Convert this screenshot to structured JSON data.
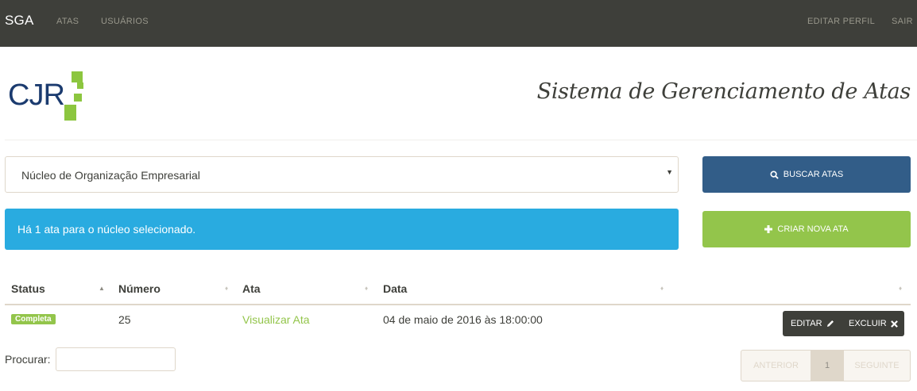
{
  "navbar": {
    "brand": "SGA",
    "links": [
      "ATAS",
      "USUÁRIOS"
    ],
    "right_links": [
      "EDITAR PERFIL",
      "SAIR"
    ]
  },
  "header": {
    "logo_text": "CJR",
    "title": "Sistema de Gerenciamento de Atas"
  },
  "filter": {
    "selected": "Núcleo de Organização Empresarial"
  },
  "buttons": {
    "search": "BUSCAR ATAS",
    "create": "CRIAR NOVA ATA"
  },
  "alert": {
    "text": "Há 1 ata para o núcleo selecionado."
  },
  "table": {
    "headers": [
      "Status",
      "Número",
      "Ata",
      "Data"
    ],
    "rows": [
      {
        "status": "Completa",
        "numero": "25",
        "ata": "Visualizar Ata",
        "data": "04 de maio de 2016 às 18:00:00",
        "edit": "EDITAR",
        "delete": "EXCLUIR"
      }
    ]
  },
  "search": {
    "label": "Procurar:",
    "value": ""
  },
  "pagination": {
    "prev": "ANTERIOR",
    "current": "1",
    "next": "SEGUINTE"
  },
  "colors": {
    "navbar": "#3e3f3a",
    "primary": "#325d88",
    "success": "#93c54b",
    "info": "#29abe0"
  }
}
